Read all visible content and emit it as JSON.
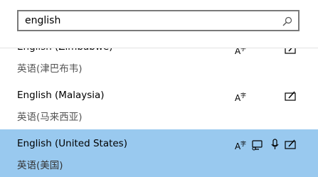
{
  "search": {
    "value": "english",
    "placeholder": ""
  },
  "languages": [
    {
      "name": "English (Zimbabwe)",
      "native": "英语(津巴布韦)"
    },
    {
      "name": "English (Malaysia)",
      "native": "英语(马来西亚)"
    },
    {
      "name": "English (United States)",
      "native": "英语(美国)"
    }
  ],
  "icons": {
    "display_language": "display-language-icon",
    "handwriting": "handwriting-icon",
    "text_to_speech": "text-to-speech-icon",
    "speech": "speech-recognition-icon"
  },
  "colors": {
    "selected_bg": "#99c9ef",
    "border": "#7a7a7a"
  }
}
